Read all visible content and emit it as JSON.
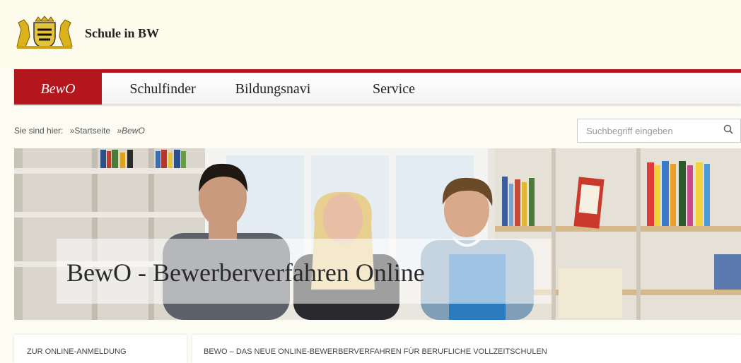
{
  "header": {
    "site_title": "Schule in BW",
    "logo_icon": "baden-wuerttemberg-coat-of-arms-icon"
  },
  "nav": {
    "items": [
      {
        "label": "BewO",
        "active": true
      },
      {
        "label": "Schulfinder",
        "active": false
      },
      {
        "label": "Bildungsnavi",
        "active": false
      },
      {
        "label": "Service",
        "active": false
      }
    ],
    "accent_color": "#b4161e"
  },
  "breadcrumb": {
    "prefix": "Sie sind hier:",
    "items": [
      "»Startseite",
      "»BewO"
    ]
  },
  "search": {
    "placeholder": "Suchbegriff eingeben",
    "icon": "search-icon"
  },
  "hero": {
    "title": "BewO - Bewerberverfahren Online"
  },
  "sidebar": {
    "heading": "ZUR ONLINE-ANMELDUNG"
  },
  "main": {
    "heading": "BEWO – DAS NEUE ONLINE-BEWERBERVERFAHREN FÜR BERUFLICHE VOLLZEITSCHULEN"
  }
}
